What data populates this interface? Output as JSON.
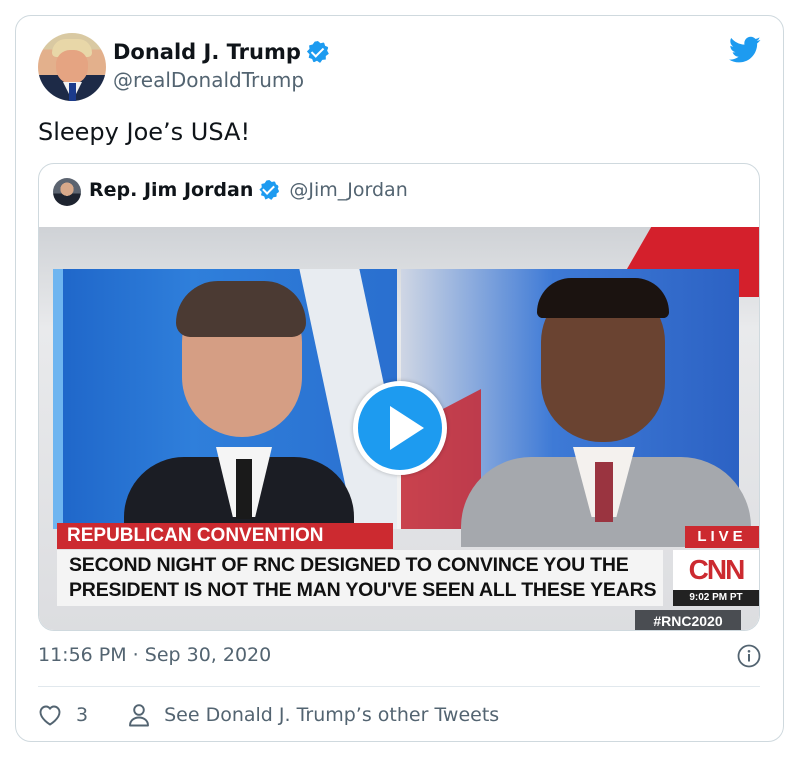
{
  "tweet": {
    "author_name": "Donald J. Trump",
    "author_handle": "@realDonaldTrump",
    "text": "Sleepy Joe’s USA!",
    "timestamp": "11:56 PM · Sep 30, 2020",
    "like_count": "3",
    "other_tweets_link": "See Donald J. Trump’s other Tweets"
  },
  "quoted": {
    "author_name": "Rep. Jim Jordan",
    "author_handle": "@Jim_Jordan"
  },
  "video": {
    "banner": "REPUBLICAN CONVENTION",
    "headline_line1": "SECOND NIGHT OF RNC DESIGNED TO CONVINCE YOU THE",
    "headline_line2": "PRESIDENT IS NOT THE MAN YOU'VE SEEN ALL THESE YEARS",
    "live_label": "LIVE",
    "network_logo": "CNN",
    "time": "9:02 PM PT",
    "hashtag": "#RNC2020"
  },
  "icons": [
    "twitter-bird-icon",
    "verified-badge-icon",
    "play-icon",
    "info-icon",
    "heart-icon",
    "person-icon"
  ],
  "colors": {
    "accent": "#1d9bf0",
    "text_primary": "#0f1419",
    "text_secondary": "#536471",
    "border": "#cfd9de",
    "cnn_red": "#cc2a30"
  }
}
